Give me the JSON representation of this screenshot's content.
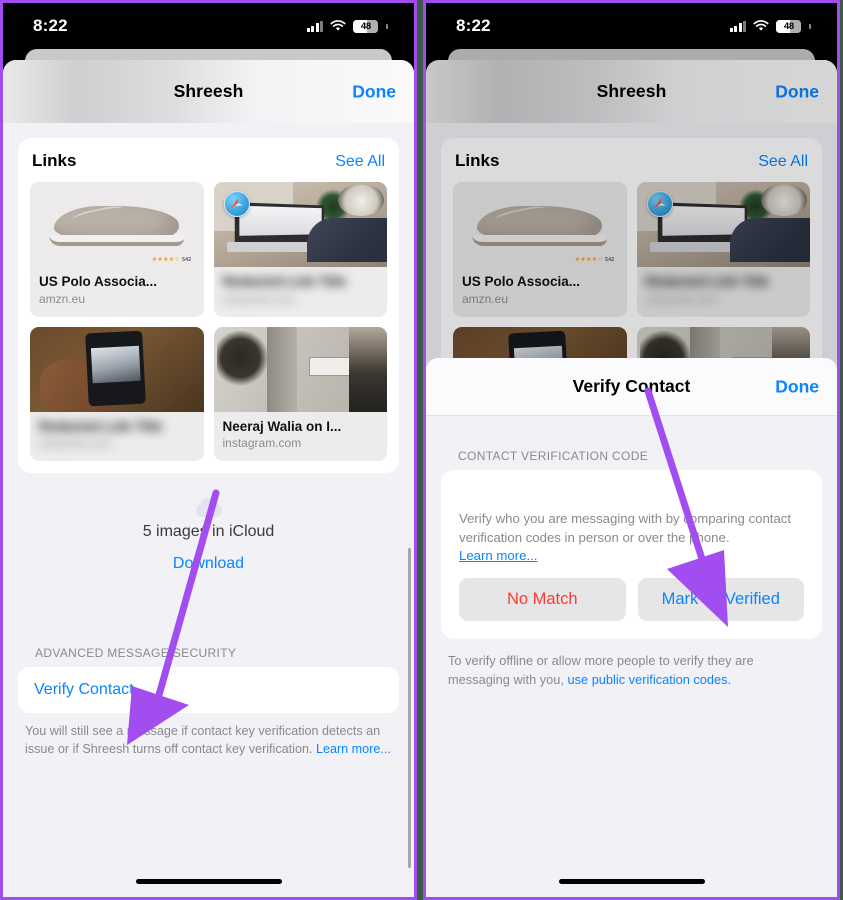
{
  "status_bar": {
    "clock": "8:22",
    "battery_level": "48",
    "signal_icon": "cellular-signal-icon",
    "wifi_icon": "wifi-icon",
    "battery_icon": "battery-icon"
  },
  "accent_colors": {
    "ios_blue": "#0a84ff",
    "ios_red": "#ff3b30",
    "annotation_purple": "#a24df0",
    "frame_border": "#a24df0",
    "sheet_background": "#f2f1f6",
    "card_background": "#ffffff"
  },
  "left_phone": {
    "sheet": {
      "title": "Shreesh",
      "done_label": "Done"
    },
    "links_card": {
      "header_label": "Links",
      "see_all_label": "See All",
      "tiles": [
        {
          "title": "US Polo Associa...",
          "domain": "amzn.eu",
          "blurred": false,
          "art": "shoe"
        },
        {
          "title": "",
          "domain": "",
          "blurred": true,
          "art": "desk",
          "badge_icon": "safari-icon"
        },
        {
          "title": "",
          "domain": "",
          "blurred": true,
          "art": "phone"
        },
        {
          "title": "Neeraj Walia on I...",
          "domain": "instagram.com",
          "blurred": false,
          "art": "room"
        }
      ]
    },
    "icloud": {
      "icon": "cloud-icon",
      "count_label": "5 images in iCloud",
      "download_label": "Download"
    },
    "advanced_security": {
      "section_header": "ADVANCED MESSAGE SECURITY",
      "verify_contact_label": "Verify Contact...",
      "footnote_text": "You will still see a message if contact key verification detects an issue or if Shreesh turns off contact key verification. ",
      "footnote_link": "Learn more..."
    }
  },
  "right_phone": {
    "sheet": {
      "title": "Shreesh",
      "done_label": "Done"
    },
    "links_card": {
      "header_label": "Links",
      "see_all_label": "See All",
      "tiles": [
        {
          "title": "US Polo Associa...",
          "domain": "amzn.eu",
          "blurred": false,
          "art": "shoe"
        },
        {
          "title": "",
          "domain": "",
          "blurred": true,
          "art": "desk",
          "badge_icon": "safari-icon"
        },
        {
          "title": "",
          "domain": "",
          "blurred": true,
          "art": "phone"
        },
        {
          "title": "",
          "domain": "",
          "blurred": true,
          "art": "room"
        }
      ]
    },
    "verify_sheet": {
      "title": "Verify Contact",
      "done_label": "Done",
      "section_header": "CONTACT VERIFICATION CODE",
      "description": "Verify who you are messaging with by comparing contact verification codes in person or over the phone.",
      "learn_more_label": "Learn more...",
      "no_match_button": "No Match",
      "mark_verified_button": "Mark as Verified",
      "footnote_text": "To verify offline or allow more people to verify they are messaging with you, ",
      "footnote_link": "use public verification codes."
    }
  },
  "annotations": [
    {
      "name": "arrow-to-verify-contact",
      "target": "Verify Contact...",
      "color": "#a24df0"
    },
    {
      "name": "arrow-to-mark-as-verified",
      "target": "Mark as Verified",
      "color": "#a24df0"
    }
  ]
}
